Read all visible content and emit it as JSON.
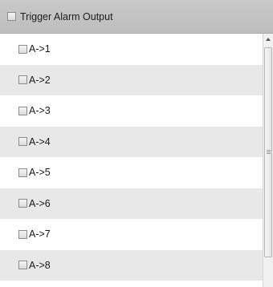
{
  "header": {
    "label": "Trigger Alarm Output",
    "checked": false
  },
  "outputs": [
    {
      "label": "A->1",
      "checked": false
    },
    {
      "label": "A->2",
      "checked": false
    },
    {
      "label": "A->3",
      "checked": false
    },
    {
      "label": "A->4",
      "checked": false
    },
    {
      "label": "A->5",
      "checked": false
    },
    {
      "label": "A->6",
      "checked": false
    },
    {
      "label": "A->7",
      "checked": false
    },
    {
      "label": "A->8",
      "checked": false
    }
  ],
  "icons": {
    "checkbox": "checkbox-unchecked-icon",
    "scroll_up": "triangle-up-icon",
    "grip": "grip-lines-icon"
  }
}
